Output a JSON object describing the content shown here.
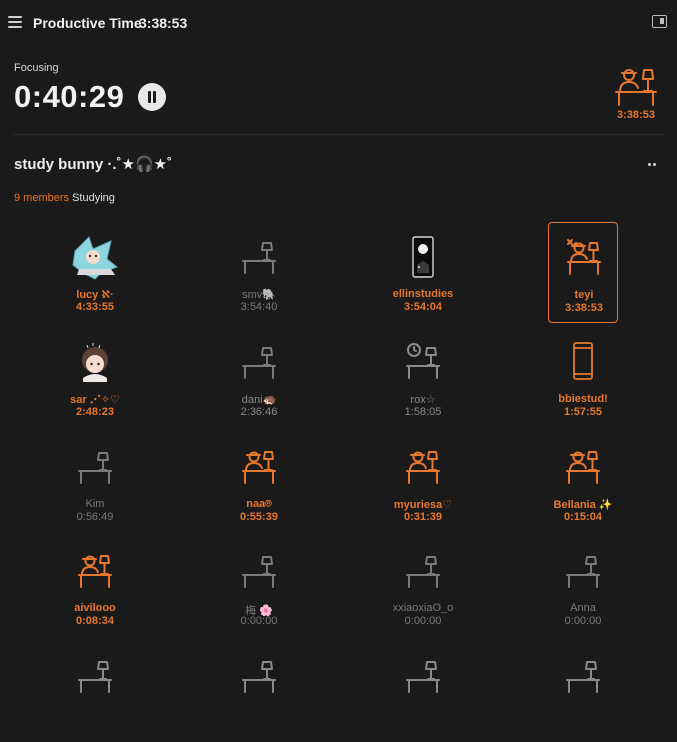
{
  "header": {
    "title": "Productive Time",
    "total_time": "3:38:53",
    "icons": [
      "menu-icon",
      "sidebar-panel-icon"
    ]
  },
  "focus": {
    "label": "Focusing",
    "timer": "0:40:29",
    "self_time": "3:38:53"
  },
  "room": {
    "name": "study bunny ·.˚★🎧★˚",
    "member_count": "9 members",
    "status": "Studying"
  },
  "colors": {
    "accent": "#e8772e",
    "background": "#1a1a1a",
    "idle": "#7a7a7a"
  },
  "members": [
    {
      "name": "lucy ℵ·",
      "time": "4:33:55",
      "state": "active",
      "avatar": "anime-girl-avatar"
    },
    {
      "name": "smv🐘",
      "time": "3:54:40",
      "state": "idle",
      "avatar": "empty-desk-icon"
    },
    {
      "name": "ellinstudies",
      "time": "3:54:04",
      "state": "active",
      "avatar": "moon-card-avatar"
    },
    {
      "name": "teyi",
      "time": "3:38:53",
      "state": "active",
      "avatar": "person-at-desk-icon"
    },
    {
      "name": "sar ⋰✧♡",
      "time": "2:48:23",
      "state": "active",
      "avatar": "chibi-girl-avatar"
    },
    {
      "name": "dani🦔",
      "time": "2:36:46",
      "state": "partial",
      "avatar": "empty-desk-icon"
    },
    {
      "name": "rox☆",
      "time": "1:58:05",
      "state": "partial",
      "avatar": "desk-with-clock-icon"
    },
    {
      "name": "bbiestud!",
      "time": "1:57:55",
      "state": "active",
      "avatar": "phone-icon"
    },
    {
      "name": "Kim",
      "time": "0:56:49",
      "state": "idle",
      "avatar": "empty-desk-icon"
    },
    {
      "name": "naa⌾",
      "time": "0:55:39",
      "state": "active",
      "avatar": "person-at-desk-icon"
    },
    {
      "name": "myuriesa♡",
      "time": "0:31:39",
      "state": "active",
      "avatar": "person-at-desk-icon"
    },
    {
      "name": "Bellania ✨",
      "time": "0:15:04",
      "state": "active",
      "avatar": "person-at-desk-icon"
    },
    {
      "name": "aivilooo",
      "time": "0:08:34",
      "state": "active",
      "avatar": "person-at-desk-icon"
    },
    {
      "name": "梅 🌸",
      "time": "0:00:00",
      "state": "idle",
      "avatar": "empty-desk-icon"
    },
    {
      "name": "xxiaoxiaO_o",
      "time": "0:00:00",
      "state": "idle",
      "avatar": "empty-desk-icon"
    },
    {
      "name": "Anna",
      "time": "0:00:00",
      "state": "idle",
      "avatar": "empty-desk-icon"
    },
    {
      "name": "",
      "time": "",
      "state": "idle",
      "avatar": "empty-desk-icon"
    },
    {
      "name": "",
      "time": "",
      "state": "idle",
      "avatar": "empty-desk-icon"
    },
    {
      "name": "",
      "time": "",
      "state": "idle",
      "avatar": "empty-desk-icon"
    },
    {
      "name": "",
      "time": "",
      "state": "idle",
      "avatar": "empty-desk-icon"
    }
  ]
}
